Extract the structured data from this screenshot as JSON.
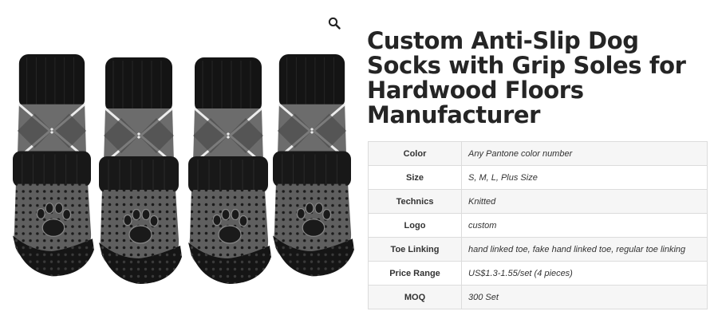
{
  "product": {
    "title": "Custom Anti-Slip Dog Socks with Grip Soles for Hardwood Floors Manufacturer",
    "image_alt": "Four black and gray argyle dog socks with dotted grip soles and paw print",
    "zoom_icon": "magnifier-icon"
  },
  "specs": [
    {
      "label": "Color",
      "value": "Any Pantone color number"
    },
    {
      "label": "Size",
      "value": "S, M, L, Plus Size"
    },
    {
      "label": "Technics",
      "value": "Knitted"
    },
    {
      "label": "Logo",
      "value": "custom"
    },
    {
      "label": "Toe Linking",
      "value": "hand linked toe, fake hand linked toe, regular toe linking"
    },
    {
      "label": "Price Range",
      "value": "US$1.3-1.55/set (4 pieces)"
    },
    {
      "label": "MOQ",
      "value": "300 Set"
    }
  ],
  "colors": {
    "sock_black": "#111111",
    "sock_gray": "#6e6e6e",
    "title": "#252525",
    "table_border": "#dcdcdc"
  }
}
